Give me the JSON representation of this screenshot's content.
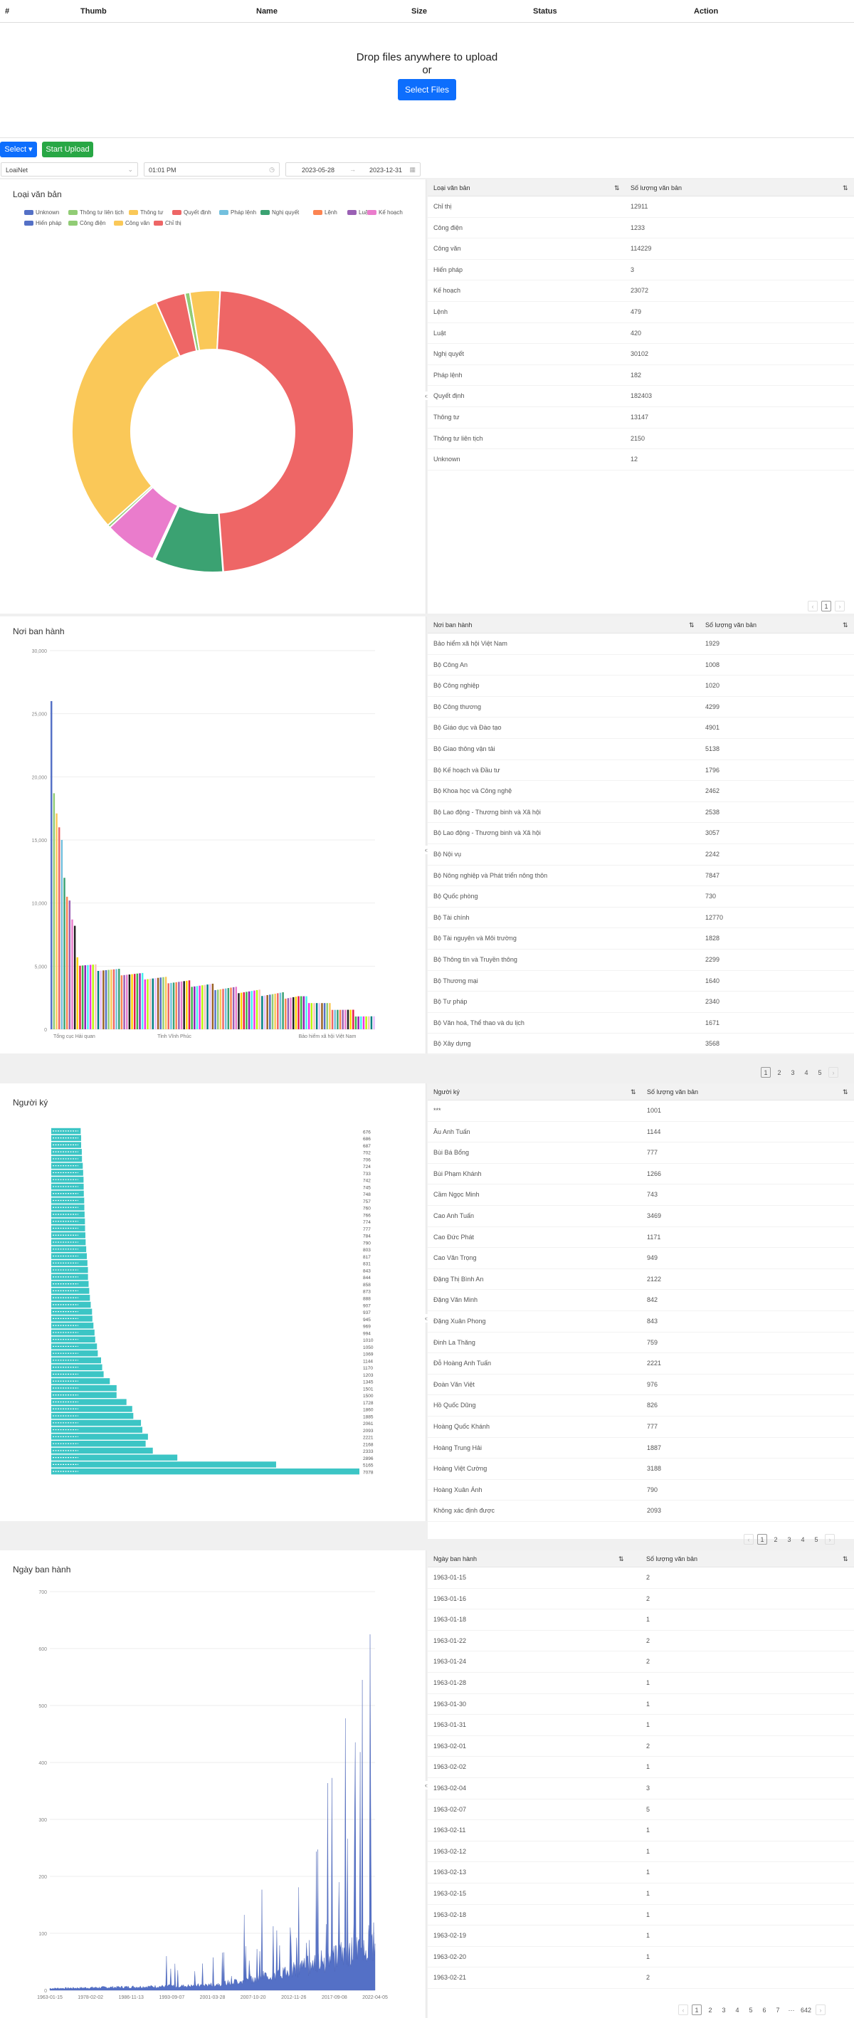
{
  "upload": {
    "columns": [
      "#",
      "Thumb",
      "Name",
      "Size",
      "Status",
      "Action"
    ],
    "drop_text": "Drop files anywhere to upload",
    "or_text": "or",
    "select_files_label": "Select Files"
  },
  "toolbar": {
    "select_label": "Select ▾",
    "start_upload_label": "Start Upload"
  },
  "filters": {
    "type_value": "LoaiNet",
    "time_value": "01:01 PM",
    "date_from": "2023-05-28",
    "date_to": "2023-12-31",
    "range_arrow": "→"
  },
  "loai": {
    "title": "Loại văn bản",
    "legend": [
      {
        "label": "Unknown",
        "color": "#5470c6"
      },
      {
        "label": "Thông tư liên tịch",
        "color": "#91cc75"
      },
      {
        "label": "Thông tư",
        "color": "#fac858"
      },
      {
        "label": "Quyết định",
        "color": "#ee6666"
      },
      {
        "label": "Pháp lệnh",
        "color": "#73c0de"
      },
      {
        "label": "Nghị quyết",
        "color": "#3ba272"
      },
      {
        "label": "Lệnh",
        "color": "#fc8452"
      },
      {
        "label": "Luật",
        "color": "#9a60b4"
      },
      {
        "label": "Kế hoạch",
        "color": "#ea7ccc"
      },
      {
        "label": "Hiến pháp",
        "color": "#5470c6"
      },
      {
        "label": "Công điện",
        "color": "#91cc75"
      },
      {
        "label": "Công văn",
        "color": "#fac858"
      },
      {
        "label": "Chỉ thị",
        "color": "#ee6666"
      }
    ],
    "table": {
      "col1": "Loại văn bản",
      "col2": "Số lượng văn bản",
      "rows": [
        [
          "Chỉ thị",
          "12911"
        ],
        [
          "Công điện",
          "1233"
        ],
        [
          "Công văn",
          "114229"
        ],
        [
          "Hiến pháp",
          "3"
        ],
        [
          "Kế hoạch",
          "23072"
        ],
        [
          "Lệnh",
          "479"
        ],
        [
          "Luật",
          "420"
        ],
        [
          "Nghị quyết",
          "30102"
        ],
        [
          "Pháp lệnh",
          "182"
        ],
        [
          "Quyết định",
          "182403"
        ],
        [
          "Thông tư",
          "13147"
        ],
        [
          "Thông tư liên tịch",
          "2150"
        ],
        [
          "Unknown",
          "12"
        ]
      ]
    },
    "pager": [
      "‹",
      "1",
      "›"
    ]
  },
  "noi": {
    "title": "Nơi ban hành",
    "yticks": [
      "30,000",
      "25,000",
      "20,000",
      "15,000",
      "10,000",
      "5,000",
      "0"
    ],
    "xticks": [
      "Tổng cục Hải quan",
      "Tỉnh Vĩnh Phúc",
      "Bảo hiểm xã hội Việt Nam"
    ],
    "table": {
      "col1": "Nơi ban hành",
      "col2": "Số lượng văn bản",
      "rows": [
        [
          "Bảo hiểm xã hội Việt Nam",
          "1929"
        ],
        [
          "Bộ Công An",
          "1008"
        ],
        [
          "Bộ Công nghiệp",
          "1020"
        ],
        [
          "Bộ Công thương",
          "4299"
        ],
        [
          "Bộ Giáo dục và Đào tạo",
          "4901"
        ],
        [
          "Bộ Giao thông vận tải",
          "5138"
        ],
        [
          "Bộ Kế hoạch và Đầu tư",
          "1796"
        ],
        [
          "Bộ Khoa học và Công nghệ",
          "2462"
        ],
        [
          "Bộ Lao động - Thương binh và Xã hội",
          "2538"
        ],
        [
          "Bộ Lao động - Thương binh và Xã hội",
          "3057"
        ],
        [
          "Bộ Nội vụ",
          "2242"
        ],
        [
          "Bộ Nông nghiệp và Phát triển nông thôn",
          "7847"
        ],
        [
          "Bộ Quốc phòng",
          "730"
        ],
        [
          "Bộ Tài chính",
          "12770"
        ],
        [
          "Bộ Tài nguyên và Môi trường",
          "1828"
        ],
        [
          "Bộ Thông tin và Truyền thông",
          "2299"
        ],
        [
          "Bộ Thương mại",
          "1640"
        ],
        [
          "Bộ Tư pháp",
          "2340"
        ],
        [
          "Bộ Văn hoá, Thể thao và du lịch",
          "1671"
        ],
        [
          "Bộ Xây dựng",
          "3568"
        ]
      ]
    },
    "pager": [
      "1",
      "2",
      "3",
      "4",
      "5",
      "›"
    ]
  },
  "nguoi": {
    "title": "Người ký",
    "bar_values": [
      "676",
      "686",
      "687",
      "702",
      "706",
      "724",
      "733",
      "742",
      "745",
      "748",
      "757",
      "760",
      "766",
      "774",
      "777",
      "784",
      "790",
      "803",
      "817",
      "831",
      "843",
      "844",
      "858",
      "873",
      "888",
      "907",
      "937",
      "945",
      "969",
      "994",
      "1010",
      "1050",
      "1069",
      "1144",
      "1170",
      "1203",
      "1345",
      "1501",
      "1500",
      "1728",
      "1860",
      "1885",
      "2061",
      "2093",
      "2221",
      "2168",
      "2333",
      "2896",
      "5165",
      "7078"
    ],
    "table": {
      "col1": "Người ký",
      "col2": "Số lượng văn bản",
      "rows": [
        [
          "***",
          "1001"
        ],
        [
          "Âu Anh Tuấn",
          "1144"
        ],
        [
          "Bùi Bá Bổng",
          "777"
        ],
        [
          "Bùi Phạm Khánh",
          "1266"
        ],
        [
          "Cầm Ngọc Minh",
          "743"
        ],
        [
          "Cao Anh Tuấn",
          "3469"
        ],
        [
          "Cao Đức Phát",
          "1171"
        ],
        [
          "Cao Văn Trọng",
          "949"
        ],
        [
          "Đặng Thị Bình An",
          "2122"
        ],
        [
          "Đặng Văn Minh",
          "842"
        ],
        [
          "Đặng Xuân Phong",
          "843"
        ],
        [
          "Đinh La Thăng",
          "759"
        ],
        [
          "Đỗ Hoàng Anh Tuấn",
          "2221"
        ],
        [
          "Đoàn Văn Việt",
          "976"
        ],
        [
          "Hồ Quốc Dũng",
          "826"
        ],
        [
          "Hoàng Quốc Khánh",
          "777"
        ],
        [
          "Hoàng Trung Hải",
          "1887"
        ],
        [
          "Hoàng Việt Cường",
          "3188"
        ],
        [
          "Hoàng Xuân Ánh",
          "790"
        ],
        [
          "Không xác định được",
          "2093"
        ]
      ]
    },
    "pager": [
      "‹",
      "1",
      "2",
      "3",
      "4",
      "5",
      "›"
    ]
  },
  "ngay": {
    "title": "Ngày ban hành",
    "yticks": [
      "700",
      "600",
      "500",
      "400",
      "300",
      "200",
      "100",
      "0"
    ],
    "xticks": [
      "1963-01-15",
      "1978-02-02",
      "1986-11-13",
      "1993-09-07",
      "2001-03-28",
      "2007-10-20",
      "2012-11-26",
      "2017-09-08",
      "2022-04-05"
    ],
    "table": {
      "col1": "Ngày ban hành",
      "col2": "Số lượng văn bản",
      "rows": [
        [
          "1963-01-15",
          "2"
        ],
        [
          "1963-01-16",
          "2"
        ],
        [
          "1963-01-18",
          "1"
        ],
        [
          "1963-01-22",
          "2"
        ],
        [
          "1963-01-24",
          "2"
        ],
        [
          "1963-01-28",
          "1"
        ],
        [
          "1963-01-30",
          "1"
        ],
        [
          "1963-01-31",
          "1"
        ],
        [
          "1963-02-01",
          "2"
        ],
        [
          "1963-02-02",
          "1"
        ],
        [
          "1963-02-04",
          "3"
        ],
        [
          "1963-02-07",
          "5"
        ],
        [
          "1963-02-11",
          "1"
        ],
        [
          "1963-02-12",
          "1"
        ],
        [
          "1963-02-13",
          "1"
        ],
        [
          "1963-02-15",
          "1"
        ],
        [
          "1963-02-18",
          "1"
        ],
        [
          "1963-02-19",
          "1"
        ],
        [
          "1963-02-20",
          "1"
        ],
        [
          "1963-02-21",
          "2"
        ]
      ]
    },
    "pager": [
      "‹",
      "1",
      "2",
      "3",
      "4",
      "5",
      "6",
      "7",
      "···",
      "642",
      "›"
    ]
  },
  "chart_data": [
    {
      "type": "pie",
      "title": "Loại văn bản",
      "categories": [
        "Chỉ thị",
        "Công điện",
        "Công văn",
        "Hiến pháp",
        "Kế hoạch",
        "Lệnh",
        "Luật",
        "Nghị quyết",
        "Pháp lệnh",
        "Quyết định",
        "Thông tư",
        "Thông tư liên tịch",
        "Unknown"
      ],
      "values": [
        12911,
        1233,
        114229,
        3,
        23072,
        479,
        420,
        30102,
        182,
        182403,
        13147,
        2150,
        12
      ],
      "donut": true
    },
    {
      "type": "bar",
      "title": "Nơi ban hành",
      "ylim": [
        0,
        30000
      ],
      "categories": [
        "Tổng cục Hải quan",
        "Tỉnh Vĩnh Phúc",
        "Bảo hiểm xã hội Việt Nam"
      ],
      "values": [
        26000,
        18500,
        900
      ],
      "note_series": "approx descending values"
    },
    {
      "type": "bar",
      "title": "Người ký",
      "orientation": "horizontal",
      "values": [
        676,
        686,
        687,
        702,
        706,
        724,
        733,
        742,
        745,
        748,
        757,
        760,
        766,
        774,
        777,
        784,
        790,
        803,
        817,
        831,
        843,
        844,
        858,
        873,
        888,
        907,
        937,
        945,
        969,
        994,
        1010,
        1050,
        1069,
        1144,
        1170,
        1203,
        1345,
        1501,
        1500,
        1728,
        1860,
        1885,
        2061,
        2093,
        2221,
        2168,
        2333,
        2896,
        5165,
        7078
      ]
    },
    {
      "type": "area",
      "title": "Ngày ban hành",
      "ylim": [
        0,
        700
      ],
      "x": [
        "1963-01-15",
        "1978-02-02",
        "1986-11-13",
        "1993-09-07",
        "2001-03-28",
        "2007-10-20",
        "2012-11-26",
        "2017-09-08",
        "2022-04-05"
      ],
      "values": [
        2,
        3,
        5,
        8,
        25,
        70,
        110,
        160,
        280
      ]
    }
  ],
  "colors": {
    "palette": [
      "#5470c6",
      "#91cc75",
      "#fac858",
      "#ee6666",
      "#73c0de",
      "#3ba272",
      "#fc8452",
      "#9a60b4",
      "#ea7ccc"
    ],
    "accent_blue": "#0d6efd",
    "accent_green": "#28a745",
    "teal": "#3cc5c5"
  }
}
